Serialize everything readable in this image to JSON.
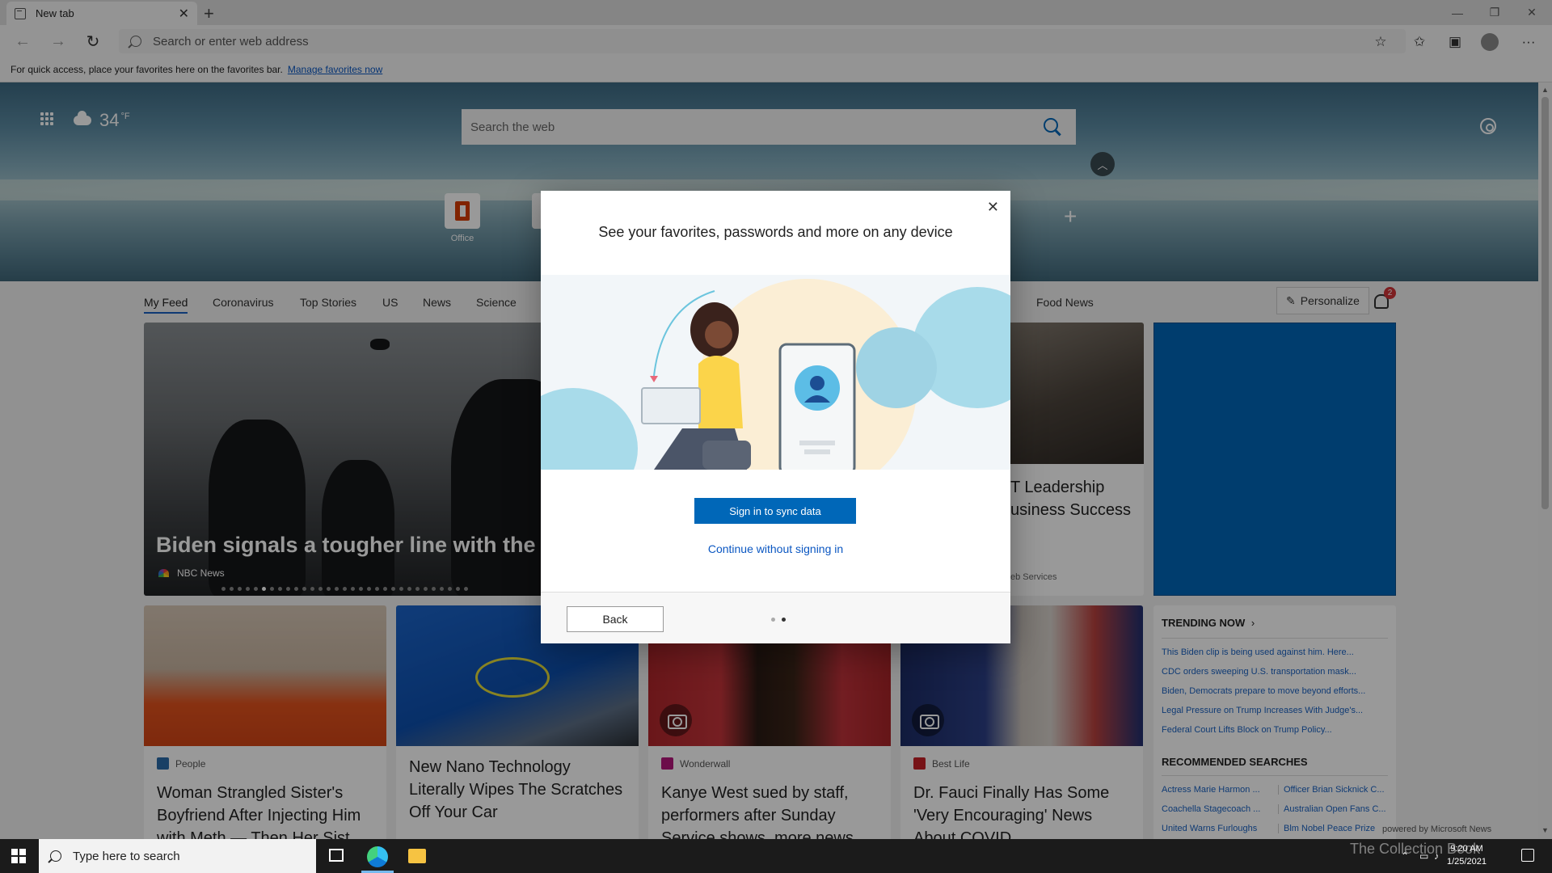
{
  "browser": {
    "tab_title": "New tab",
    "address_placeholder": "Search or enter web address",
    "favorites_bar_text": "For quick access, place your favorites here on the favorites bar.",
    "favorites_bar_link": "Manage favorites now"
  },
  "newtab": {
    "weather_temp": "34",
    "weather_unit": "°F",
    "search_placeholder": "Search the web",
    "quick_links": [
      {
        "label": "Office"
      }
    ],
    "feed_tabs": [
      "My Feed",
      "Coronavirus",
      "Top Stories",
      "US",
      "News",
      "Science",
      "Food News"
    ],
    "personalize_label": "Personalize",
    "notification_count": "2",
    "hero": {
      "title": "Biden signals a tougher line with the T",
      "source": "NBC News",
      "slide_count": 31,
      "active_slide": 5
    },
    "leader_card": {
      "title_line1": "T Leadership",
      "title_line2": "usiness Success",
      "source": "eb Services"
    },
    "cards": [
      {
        "source": "People",
        "title": "Woman Strangled Sister's Boyfriend After Injecting Him with Meth — Then Her Sist..."
      },
      {
        "source": "",
        "title": "New Nano Technology Literally Wipes The Scratches Off Your Car"
      },
      {
        "source": "Wonderwall",
        "title": "Kanye West sued by staff, performers after Sunday Service shows, more news"
      },
      {
        "source": "Best Life",
        "title": "Dr. Fauci Finally Has Some 'Very Encouraging' News About COVID"
      }
    ],
    "trending": {
      "heading": "TRENDING NOW",
      "items": [
        "This Biden clip is being used against him. Here...",
        "CDC orders sweeping U.S. transportation mask...",
        "Biden, Democrats prepare to move beyond efforts...",
        "Legal Pressure on Trump Increases With Judge's...",
        "Federal Court Lifts Block on Trump Policy..."
      ]
    },
    "recommended": {
      "heading": "RECOMMENDED SEARCHES",
      "items": [
        "Actress Marie Harmon ...",
        "Officer Brian Sicknick C...",
        "Coachella Stagecoach ...",
        "Australian Open Fans C...",
        "United Warns Furloughs",
        "Blm Nobel Peace Prize"
      ]
    },
    "powered_by": "powered by Microsoft News"
  },
  "dialog": {
    "title": "See your favorites, passwords and more on any device",
    "primary_button": "Sign in to sync data",
    "secondary_link": "Continue without signing in",
    "back_button": "Back",
    "pages": 2,
    "current_page": 2
  },
  "taskbar": {
    "search_placeholder": "Type here to search",
    "time": "9:20 AM",
    "date": "1/25/2021",
    "watermark": "The Collection Book"
  },
  "colors": {
    "accent": "#0067b8",
    "link": "#0b57c2"
  }
}
